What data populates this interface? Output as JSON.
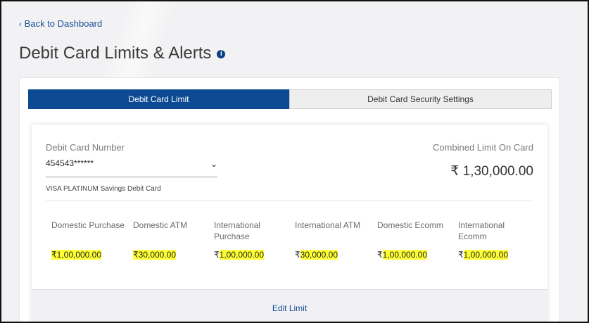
{
  "nav": {
    "back_label": "Back to Dashboard",
    "back_icon": "chevron-left-icon"
  },
  "page": {
    "title": "Debit Card Limits & Alerts",
    "info_icon": "i"
  },
  "tabs": [
    {
      "label": "Debit Card Limit",
      "active": true
    },
    {
      "label": "Debit Card Security Settings",
      "active": false
    }
  ],
  "card": {
    "number_label": "Debit Card Number",
    "number_value": "454543******",
    "type": "VISA PLATINUM Savings Debit Card",
    "combined_label": "Combined Limit On Card",
    "combined_value": "₹ 1,30,000.00"
  },
  "limits": [
    {
      "name": "Domestic Purchase",
      "currency": "₹",
      "amount": "1,00,000.00"
    },
    {
      "name": "Domestic ATM",
      "currency": "₹",
      "amount": "30,000.00"
    },
    {
      "name": "International Purchase",
      "currency": "₹",
      "amount": "1,00,000.00"
    },
    {
      "name": "International ATM",
      "currency": "₹",
      "amount": "30,000.00"
    },
    {
      "name": "Domestic Ecomm",
      "currency": "₹",
      "amount": "1,00,000.00"
    },
    {
      "name": "International Ecomm",
      "currency": "₹",
      "amount": "1,00,000.00"
    }
  ],
  "actions": {
    "edit_label": "Edit Limit"
  },
  "colors": {
    "primary": "#0d4a93",
    "link": "#1a4f95",
    "highlight": "#ffff33"
  }
}
